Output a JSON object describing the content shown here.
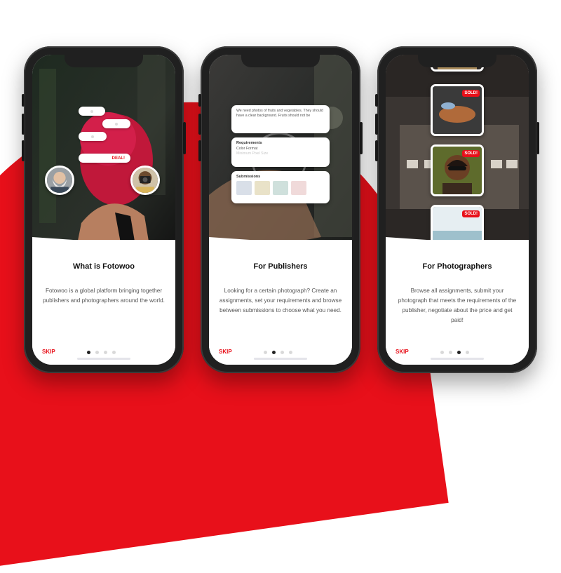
{
  "screens": [
    {
      "title": "What is Fotowoo",
      "description": "Fotowoo is a global platform bringing together publishers and photographers around the world.",
      "skip_label": "SKIP",
      "active_dot": 1,
      "chat": {
        "deal_label": "DEAL!"
      }
    },
    {
      "title": "For Publishers",
      "description": "Looking for a certain photograph? Create an assignments, set your requirements and browse between submissions to choose what you need.",
      "skip_label": "SKIP",
      "active_dot": 2,
      "assignment": {
        "brief": "We need photos of fruits and vegetables. They should have a clear background. Fruits should not be",
        "requirements_title": "Requirements",
        "requirement_1": "Color Format",
        "requirement_2": "Minimum Pixel Size",
        "submissions_title": "Submissions"
      }
    },
    {
      "title": "For Photographers",
      "description": "Browse all assignments, submit your photograph that meets the requirements of the publisher, negotiate about the price and get paid!",
      "skip_label": "SKIP",
      "active_dot": 3,
      "sold_label": "SOLD!"
    }
  ],
  "page_count": 4,
  "colors": {
    "accent": "#e8101a",
    "phone_frame": "#202020",
    "text_dark": "#111111",
    "text_body": "#555555"
  }
}
